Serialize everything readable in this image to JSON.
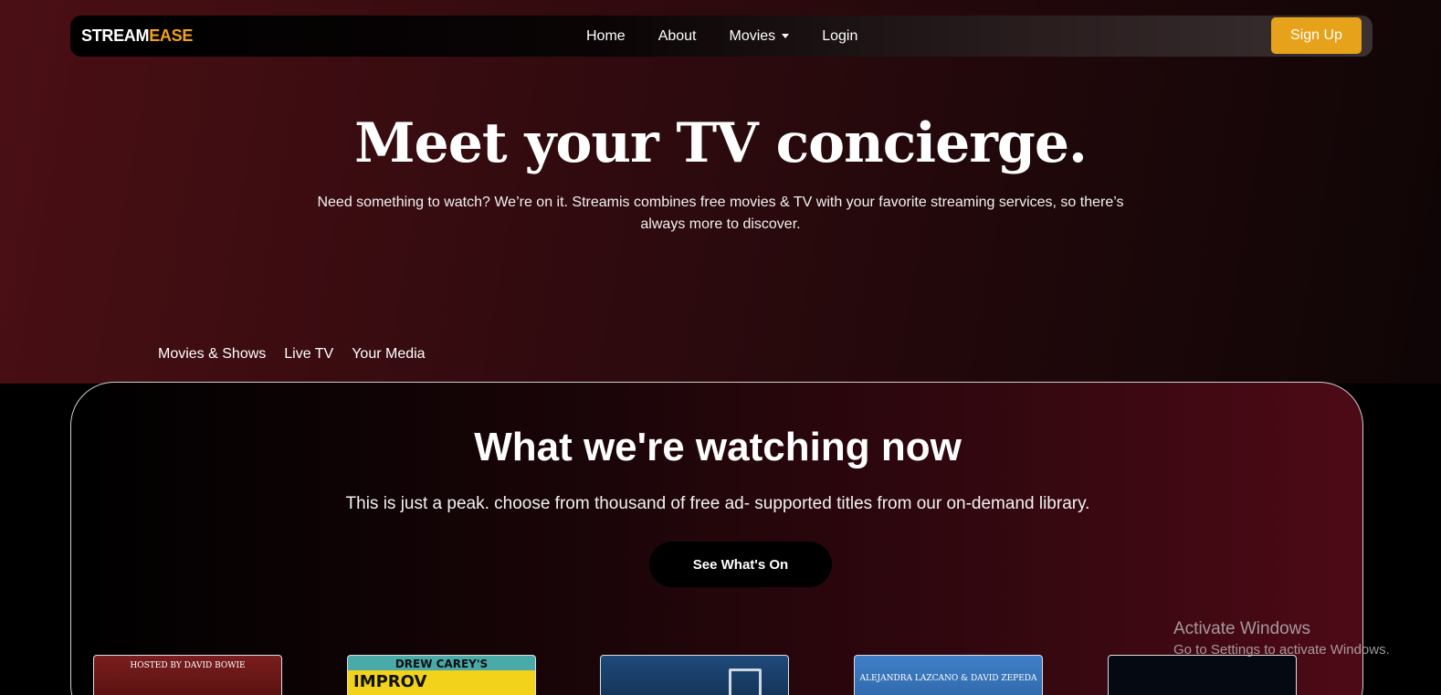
{
  "navbar": {
    "logo_part1": "STREAM",
    "logo_part2": "EASE",
    "links": [
      "Home",
      "About",
      "Movies",
      "Login"
    ],
    "signup_label": "Sign Up"
  },
  "hero": {
    "title": "Meet your TV concierge.",
    "subtitle": "Need something to watch? We’re on it. Streamis combines free movies & TV with your favorite streaming services, so there’s always more to discover.",
    "tabs": [
      "Movies & Shows",
      "Live TV",
      "Your Media"
    ]
  },
  "watching": {
    "title": "What we're watching now",
    "subtitle": "This is just a peak. choose from thousand of free ad- supported titles from our on-demand library.",
    "button_label": "See What's On",
    "posters": [
      {
        "caption": "HOSTED BY DAVID BOWIE"
      },
      {
        "caption": "DREW CAREY'S",
        "big": "IMPROV"
      },
      {
        "caption": ""
      },
      {
        "caption": "ALEJANDRA LAZCANO & DAVID ZEPEDA"
      },
      {
        "caption": ""
      }
    ]
  },
  "watermark": {
    "title": "Activate Windows",
    "subtitle": "Go to Settings to activate Windows."
  },
  "colors": {
    "accent": "#e5a21a",
    "logo_accent": "#f0a020",
    "hero_bg": "#3a0c10"
  }
}
